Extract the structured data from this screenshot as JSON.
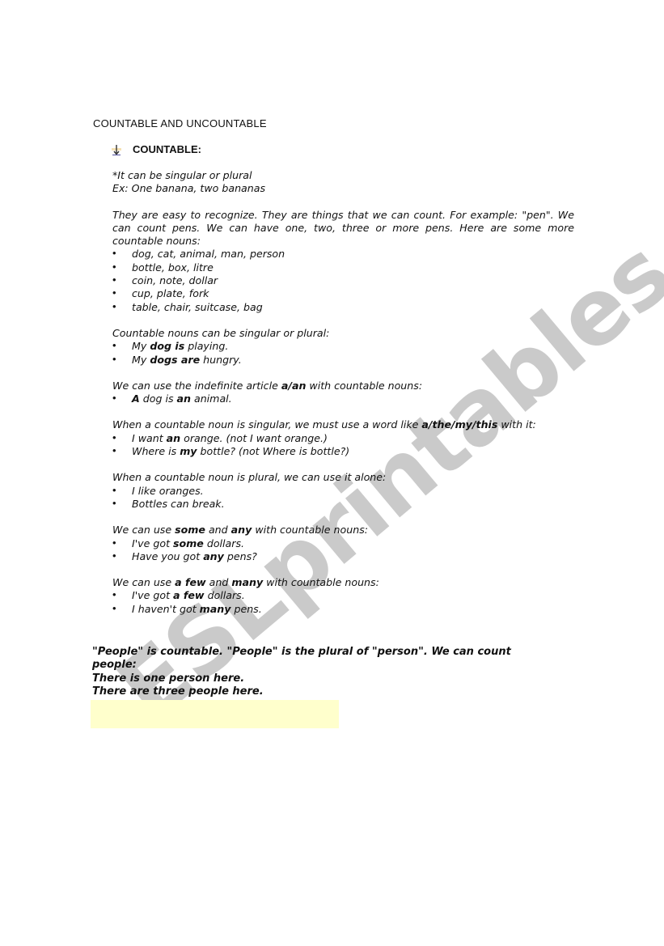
{
  "document": {
    "title": "COUNTABLE AND UNCOUNTABLE",
    "section_heading": "COUNTABLE:",
    "section_icon": "down-arrow-bullet-icon",
    "intro": {
      "line1": "*It can be singular or plural",
      "line2": "Ex: One banana, two bananas"
    },
    "paragraph1": "They are easy to recognize. They are things that we can count. For example: \"pen\". We can count pens. We can have one, two, three or more pens. Here are some more countable nouns:",
    "noun_list": [
      "dog, cat, animal, man, person",
      "bottle, box, litre",
      "coin, note, dollar",
      "cup, plate, fork",
      "table, chair, suitcase, bag"
    ],
    "singular_plural": {
      "intro": "Countable nouns can be singular or plural:",
      "items": [
        {
          "pre": "My ",
          "bold": "dog is",
          "post": " playing."
        },
        {
          "pre": "My ",
          "bold": "dogs are",
          "post": " hungry."
        }
      ]
    },
    "article": {
      "intro_pre": "We can use the indefinite article ",
      "intro_bold": "a/an",
      "intro_post": " with countable nouns:",
      "item": {
        "bold1": "A",
        "mid": " dog is ",
        "bold2": "an",
        "post": " animal."
      }
    },
    "singular_rule": {
      "intro_pre": "When a countable noun is singular, we must use a word like ",
      "intro_bold": "a/the/my/this",
      "intro_post": " with it:",
      "items": [
        {
          "pre": "I want ",
          "bold": "an",
          "post": " orange. (not I want orange.)"
        },
        {
          "pre": "Where is ",
          "bold": "my",
          "post": " bottle? (not Where is bottle?)"
        }
      ]
    },
    "plural_rule": {
      "intro": "When a countable noun is plural, we can use it alone:",
      "items": [
        "I like oranges.",
        "Bottles can break."
      ]
    },
    "some_any": {
      "intro_pre": "We can use ",
      "bold1": "some",
      "mid": " and ",
      "bold2": "any",
      "intro_post": " with countable nouns:",
      "items": [
        {
          "pre": "I've got ",
          "bold": "some",
          "post": " dollars."
        },
        {
          "pre": "Have you got ",
          "bold": "any",
          "post": " pens?"
        }
      ]
    },
    "few_many": {
      "intro_pre": "We can use ",
      "bold1": "a few",
      "mid": " and ",
      "bold2": "many",
      "intro_post": " with countable nouns:",
      "items": [
        {
          "pre": "I've got ",
          "bold": "a few",
          "post": " dollars."
        },
        {
          "pre": "I haven't got ",
          "bold": "many",
          "post": " pens."
        }
      ]
    },
    "people_note": {
      "line1": "\"People\" is countable. \"People\" is the plural of \"person\". We can count people:",
      "line2": "There is one person here.",
      "line3": "There are three people here."
    },
    "highlight_color": "#ffffcc",
    "watermark": "ESLprintables.com"
  }
}
